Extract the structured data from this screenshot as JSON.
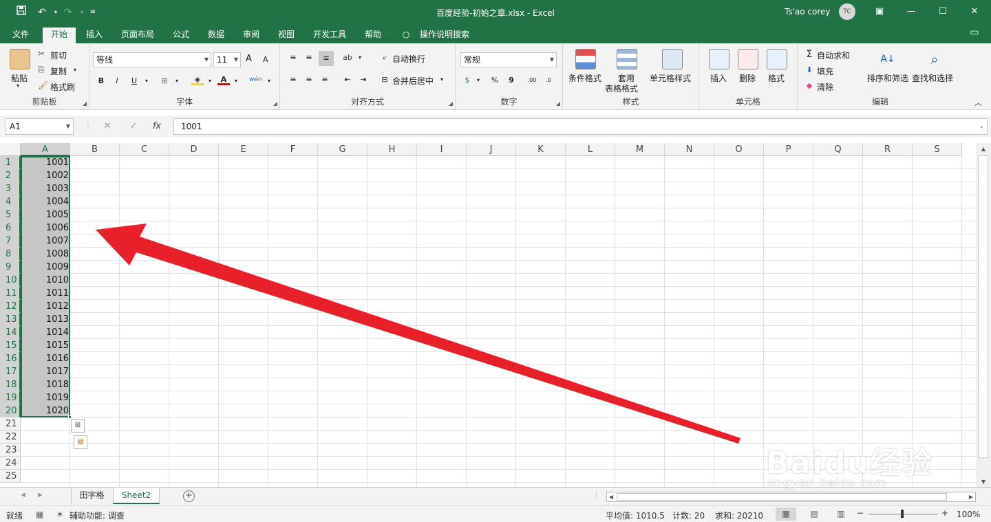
{
  "titlebar": {
    "document_title": "百度经验-初始之章.xlsx  -  Excel",
    "user_name": "Ts'ao corey",
    "avatar_initials": "TC"
  },
  "tabs": [
    "文件",
    "开始",
    "插入",
    "页面布局",
    "公式",
    "数据",
    "审阅",
    "视图",
    "开发工具",
    "帮助"
  ],
  "tell_me": "操作说明搜索",
  "ribbon": {
    "clipboard": {
      "group": "剪贴板",
      "paste": "粘贴",
      "cut": "剪切",
      "copy": "复制",
      "format_painter": "格式刷"
    },
    "font": {
      "group": "字体",
      "font_name": "等线",
      "font_size": "11",
      "bold": "B",
      "italic": "I",
      "underline": "U",
      "increase": "A",
      "decrease": "A"
    },
    "alignment": {
      "group": "对齐方式",
      "wrap": "自动换行",
      "merge": "合并后居中"
    },
    "number": {
      "group": "数字",
      "format": "常规",
      "percent": "%",
      "comma": "9"
    },
    "styles": {
      "group": "样式",
      "conditional": "条件格式",
      "table_line1": "套用",
      "table_line2": "表格格式",
      "cell_styles": "单元格样式"
    },
    "cells": {
      "group": "单元格",
      "insert": "插入",
      "delete": "删除",
      "format": "格式"
    },
    "editing": {
      "group": "编辑",
      "autosum": "自动求和",
      "fill": "填充",
      "clear": "清除",
      "sort_filter": "排序和筛选",
      "find_select": "查找和选择"
    }
  },
  "formula_bar": {
    "name_box": "A1",
    "fx": "fx",
    "value": "1001"
  },
  "columns": [
    "A",
    "B",
    "C",
    "D",
    "E",
    "F",
    "G",
    "H",
    "I",
    "J",
    "K",
    "L",
    "M",
    "N",
    "O",
    "P",
    "Q",
    "R",
    "S"
  ],
  "rows": [
    "1",
    "2",
    "3",
    "4",
    "5",
    "6",
    "7",
    "8",
    "9",
    "10",
    "11",
    "12",
    "13",
    "14",
    "15",
    "16",
    "17",
    "18",
    "19",
    "20",
    "21",
    "22",
    "23",
    "24",
    "25"
  ],
  "cell_values_A": [
    "1001",
    "1002",
    "1003",
    "1004",
    "1005",
    "1006",
    "1007",
    "1008",
    "1009",
    "1010",
    "1011",
    "1012",
    "1013",
    "1014",
    "1015",
    "1016",
    "1017",
    "1018",
    "1019",
    "1020"
  ],
  "sheets": [
    "田字格",
    "Sheet2"
  ],
  "active_sheet": "Sheet2",
  "status": {
    "ready": "就绪",
    "accessibility": "辅助功能: 调查",
    "average": "平均值: 1010.5",
    "count": "计数: 20",
    "sum": "求和: 20210",
    "zoom": "100%"
  },
  "watermark": {
    "brand": "Baidu经验",
    "url": "jingyan.baidu.com"
  },
  "colors": {
    "excel_green": "#217346",
    "annotation_red": "#e8202a"
  }
}
